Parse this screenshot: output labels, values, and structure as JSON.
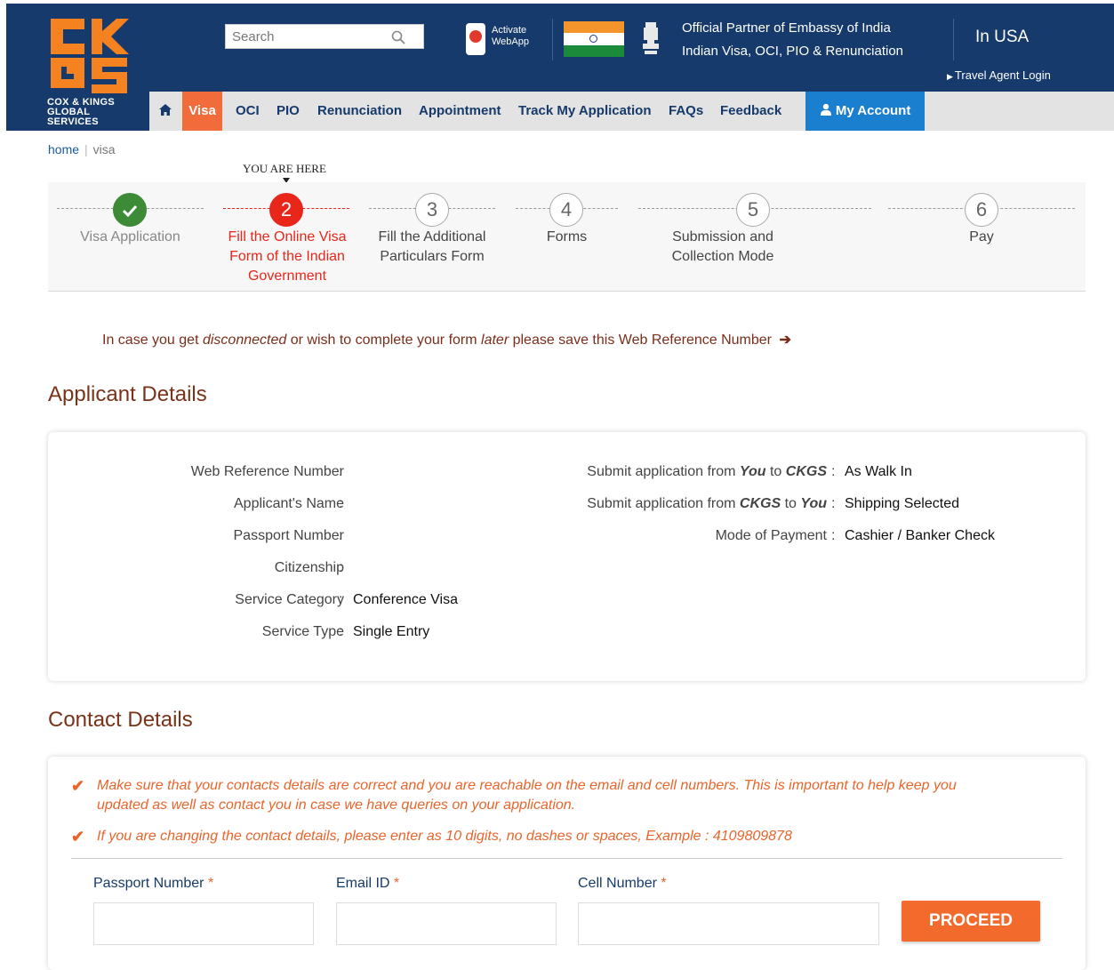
{
  "header": {
    "logo_subtitle_line1": "COX & KINGS",
    "logo_subtitle_line2": "GLOBAL SERVICES",
    "search_placeholder": "Search",
    "webapp_line1": "Activate",
    "webapp_line2": "WebApp",
    "partner_line1": "Official Partner of Embassy of India",
    "partner_line2": "Indian Visa, OCI, PIO & Renunciation",
    "region": "In USA",
    "travel_agent_login": "Travel Agent Login"
  },
  "nav": {
    "items": [
      "Visa",
      "OCI",
      "PIO",
      "Renunciation",
      "Appointment",
      "Track My Application",
      "FAQs",
      "Feedback"
    ],
    "account": "My Account",
    "home_icon": "home-icon",
    "user_icon": "user-icon"
  },
  "breadcrumb": {
    "home": "home",
    "current": "visa"
  },
  "steps": {
    "you_are_here": "YOU ARE HERE",
    "items": [
      {
        "number": "",
        "label_lines": [
          "Visa Application"
        ],
        "state": "done"
      },
      {
        "number": "2",
        "label_lines": [
          "Fill the Online Visa",
          "Form of the Indian",
          "Government"
        ],
        "state": "active"
      },
      {
        "number": "3",
        "label_lines": [
          "Fill the Additional",
          "Particulars Form"
        ],
        "state": "pending"
      },
      {
        "number": "4",
        "label_lines": [
          "Forms"
        ],
        "state": "pending"
      },
      {
        "number": "5",
        "label_lines": [
          "Submission and",
          "Collection Mode"
        ],
        "state": "pending"
      },
      {
        "number": "6",
        "label_lines": [
          "Pay"
        ],
        "state": "pending"
      }
    ]
  },
  "notice": {
    "part1": "In case you get ",
    "em1": "disconnected",
    "part2": " or wish to complete your form ",
    "em2": "later",
    "part3": " please save this Web Reference Number "
  },
  "applicant": {
    "title": "Applicant Details",
    "left": [
      {
        "key": "Web Reference Number",
        "value": ""
      },
      {
        "key": "Applicant's Name",
        "value": ""
      },
      {
        "key": "Passport Number",
        "value": ""
      },
      {
        "key": "Citizenship",
        "value": ""
      },
      {
        "key": "Service Category",
        "value": "Conference Visa"
      },
      {
        "key": "Service Type",
        "value": "Single Entry"
      }
    ],
    "right": [
      {
        "prefix": "Submit application from ",
        "b1": "You",
        "mid": " to ",
        "b2": "CKGS",
        "value": "As Walk In"
      },
      {
        "prefix": "Submit application from ",
        "b1": "CKGS",
        "mid": " to ",
        "b2": "You",
        "value": "Shipping Selected"
      },
      {
        "key": "Mode of Payment",
        "value": "Cashier / Banker Check"
      }
    ],
    "colon": ":"
  },
  "contact": {
    "title": "Contact Details",
    "tip1_line1": "Make sure that your contacts details are correct and you are reachable on the email and cell numbers. This is important to help keep you",
    "tip1_line2": "updated as well as contact you in case we have queries on your application.",
    "tip2": "If you are changing the contact details, please enter as 10 digits, no dashes or spaces, Example : 4109809878",
    "fields": [
      {
        "label": "Passport Number",
        "value": ""
      },
      {
        "label": "Email ID",
        "value": ""
      },
      {
        "label": "Cell Number",
        "value": ""
      }
    ],
    "required_mark": "*",
    "proceed": "PROCEED"
  },
  "colors": {
    "header_bg": "#163a6b",
    "accent_orange": "#f26b3a",
    "account_blue": "#1a7fcf",
    "active_red": "#e8261a",
    "done_green": "#3d8b37",
    "section_title": "#7a3219"
  }
}
